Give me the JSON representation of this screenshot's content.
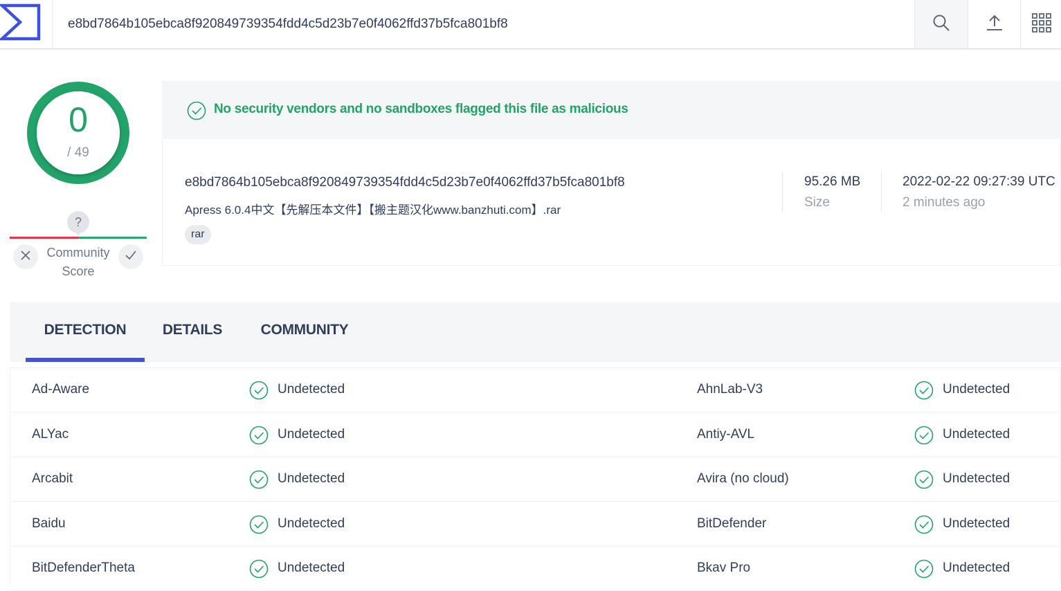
{
  "header": {
    "search_value": "e8bd7864b105ebca8f920849739354fdd4c5d23b7e0f4062ffd37b5fca801bf8",
    "icons": [
      "virustotal-logo-icon",
      "search-icon",
      "upload-icon",
      "apps-grid-icon"
    ]
  },
  "score": {
    "detections": "0",
    "total": "/ 49"
  },
  "community": {
    "unknown": "?",
    "label": "Community Score"
  },
  "banner": {
    "message": "No security vendors and no sandboxes flagged this file as malicious",
    "color": "#22a36a"
  },
  "file": {
    "hash": "e8bd7864b105ebca8f920849739354fdd4c5d23b7e0f4062ffd37b5fca801bf8",
    "name": "Apress 6.0.4中文【先解压本文件】【搬主题汉化www.banzhuti.com】.rar",
    "tag": "rar",
    "size": "95.26 MB",
    "size_label": "Size",
    "date": "2022-02-22 09:27:39 UTC",
    "date_ago": "2 minutes ago"
  },
  "tabs": [
    {
      "label": "DETECTION",
      "active": true
    },
    {
      "label": "DETAILS",
      "active": false
    },
    {
      "label": "COMMUNITY",
      "active": false
    }
  ],
  "results": [
    {
      "left": {
        "vendor": "Ad-Aware",
        "status": "Undetected"
      },
      "right": {
        "vendor": "AhnLab-V3",
        "status": "Undetected"
      }
    },
    {
      "left": {
        "vendor": "ALYac",
        "status": "Undetected"
      },
      "right": {
        "vendor": "Antiy-AVL",
        "status": "Undetected"
      }
    },
    {
      "left": {
        "vendor": "Arcabit",
        "status": "Undetected"
      },
      "right": {
        "vendor": "Avira (no cloud)",
        "status": "Undetected"
      }
    },
    {
      "left": {
        "vendor": "Baidu",
        "status": "Undetected"
      },
      "right": {
        "vendor": "BitDefender",
        "status": "Undetected"
      }
    },
    {
      "left": {
        "vendor": "BitDefenderTheta",
        "status": "Undetected"
      },
      "right": {
        "vendor": "Bkav Pro",
        "status": "Undetected"
      }
    }
  ],
  "colors": {
    "accent_blue": "#3f51e0",
    "clean_green": "#22a36a",
    "negative_red": "#e8334f"
  }
}
